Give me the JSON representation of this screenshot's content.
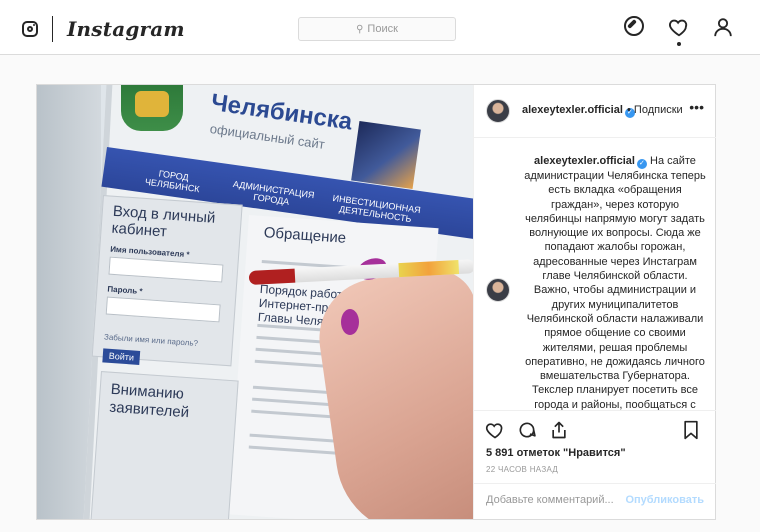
{
  "nav": {
    "logo_text": "Instagram",
    "search_placeholder": "Поиск",
    "icons": [
      "explore-icon",
      "heart-icon",
      "profile-icon"
    ]
  },
  "photo": {
    "site_title": "Челябинска",
    "site_sub": "официальный сайт",
    "nav_items": [
      "ГОРОД ЧЕЛЯБИНСК",
      "АДМИНИСТРАЦИЯ ГОРОДА",
      "ИНВЕСТИЦИОННАЯ ДЕЯТЕЛЬНОСТЬ"
    ],
    "login": {
      "title": "Вход в личный кабинет",
      "user_label": "Имя пользователя *",
      "pass_label": "Пароль *",
      "forgot": "Забыли имя или пароль?",
      "button": "Войти"
    },
    "main_title": "Обращение",
    "main_sub": "Порядок работы Интернет-приемной Главы Челябинска",
    "notice_title": "Вниманию заявителей"
  },
  "post": {
    "username": "alexeytexler.official",
    "follow_label": "Подписки",
    "more_label": "•••",
    "caption": "На сайте администрации Челябинска теперь есть вкладка «обращения граждан», через которую челябинцы напрямую могут задать волнующие их вопросы. Сюда же попадают жалобы горожан, адресованные через Инстаграм главе Челябинской области. Важно, чтобы администрации и других муниципалитетов Челябинской области налаживали прямое общение со своими жителями, решая проблемы оперативно, не дожидаясь личного вмешательства Губернатора. Текслер планирует посетить все города и районы, пообщаться с жителями и выяснить, каким образом местные",
    "likes": "5 891 отметок \"Нравится\"",
    "time_ago": "22 ЧАСОВ НАЗАД",
    "comment_placeholder": "Добавьте комментарий...",
    "publish_label": "Опубликовать"
  },
  "colors": {
    "accent_blue": "#3897f0",
    "publish_disabled": "#b3dbff",
    "border": "#dbdbdb"
  }
}
